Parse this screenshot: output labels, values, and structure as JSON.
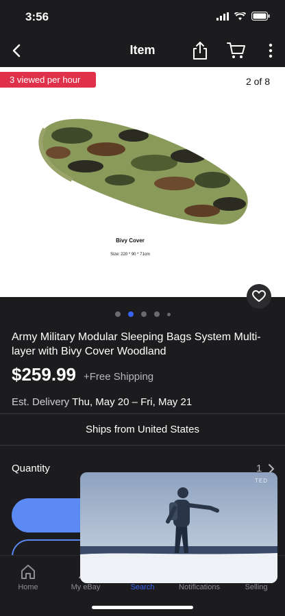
{
  "status_bar": {
    "time": "3:56",
    "icons": [
      "cellular-signal-icon",
      "wifi-icon",
      "battery-icon"
    ]
  },
  "nav": {
    "title": "Item",
    "icons": [
      "back-chevron-icon",
      "share-icon",
      "cart-icon",
      "more-vertical-icon"
    ]
  },
  "gallery": {
    "viewed_badge": "3 viewed per hour",
    "photo_counter": "2 of 8",
    "image_caption": "Bivy Cover",
    "image_size_text": "Size: 220 * 90 * 71cm",
    "dots_total": 5,
    "dots_active_index": 1
  },
  "item": {
    "title": "Army Military Modular Sleeping Bags System Multi-layer with Bivy Cover Woodland",
    "price": "$259.99",
    "shipping": "+Free Shipping",
    "delivery_label": "Est. Delivery",
    "delivery_dates": "Thu, May 20 – Fri, May 21",
    "ships_from": "Ships from United States",
    "quantity_label": "Quantity",
    "quantity_value": "1"
  },
  "tabs": [
    {
      "label": "Home",
      "icon": "home-icon",
      "active": false
    },
    {
      "label": "My eBay",
      "icon": "person-icon",
      "active": false
    },
    {
      "label": "Search",
      "icon": "search-icon",
      "active": true
    },
    {
      "label": "Notifications",
      "icon": "bell-icon",
      "active": false
    },
    {
      "label": "Selling",
      "icon": "tag-icon",
      "active": false
    }
  ],
  "video": {
    "watermark": "TED"
  },
  "colors": {
    "background": "#1c1c1e",
    "accent": "#3665f3",
    "button_blue": "#5b8af5",
    "badge_red": "#e0314b"
  }
}
